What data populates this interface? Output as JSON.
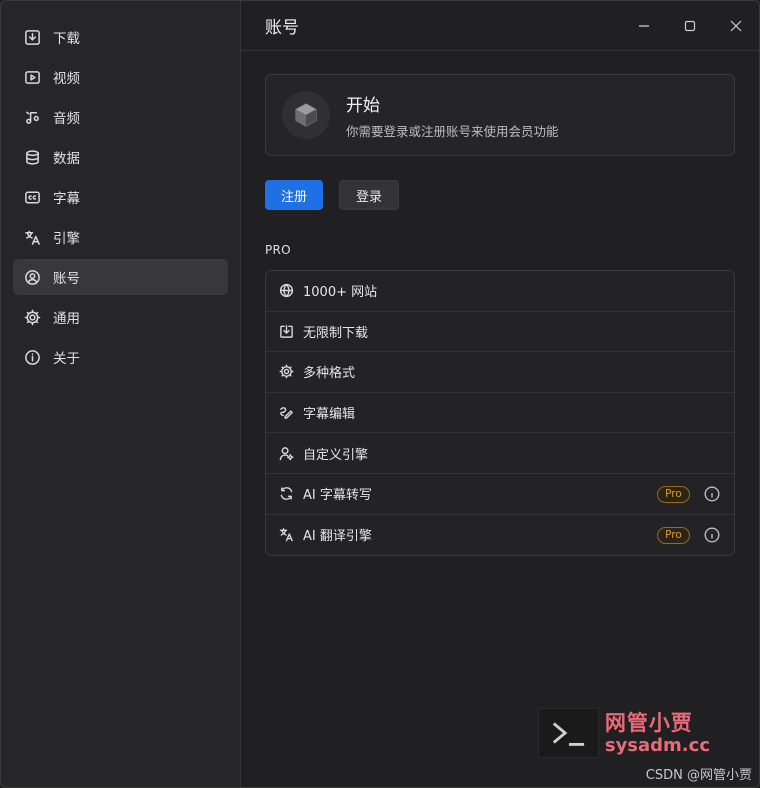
{
  "sidebar": {
    "items": [
      {
        "label": "下载",
        "icon": "download-icon",
        "active": false
      },
      {
        "label": "视频",
        "icon": "video-icon",
        "active": false
      },
      {
        "label": "音频",
        "icon": "audio-icon",
        "active": false
      },
      {
        "label": "数据",
        "icon": "database-icon",
        "active": false
      },
      {
        "label": "字幕",
        "icon": "subtitle-icon",
        "active": false
      },
      {
        "label": "引擎",
        "icon": "translate-icon",
        "active": false
      },
      {
        "label": "账号",
        "icon": "user-circle-icon",
        "active": true
      },
      {
        "label": "通用",
        "icon": "gear-icon",
        "active": false
      },
      {
        "label": "关于",
        "icon": "info-icon",
        "active": false
      }
    ]
  },
  "header": {
    "title": "账号"
  },
  "start_card": {
    "title": "开始",
    "description": "你需要登录或注册账号来使用会员功能"
  },
  "buttons": {
    "register": "注册",
    "login": "登录"
  },
  "pro_section": {
    "label": "PRO",
    "features": [
      {
        "label": "1000+ 网站",
        "icon": "globe-icon",
        "badge": ""
      },
      {
        "label": "无限制下载",
        "icon": "download-icon",
        "badge": ""
      },
      {
        "label": "多种格式",
        "icon": "gear-icon",
        "badge": ""
      },
      {
        "label": "字幕编辑",
        "icon": "subtitle-edit-icon",
        "badge": ""
      },
      {
        "label": "自定义引擎",
        "icon": "user-gear-icon",
        "badge": ""
      },
      {
        "label": "AI 字幕转写",
        "icon": "refresh-icon",
        "badge": "Pro"
      },
      {
        "label": "AI 翻译引擎",
        "icon": "translate-icon",
        "badge": "Pro"
      }
    ]
  },
  "watermark": {
    "cn": "网管小贾",
    "url": "sysadm.cc"
  },
  "footer": {
    "credit": "CSDN @网管小贾"
  },
  "colors": {
    "accent": "#1f6fe5",
    "pro_badge": "#d99a2c",
    "watermark": "#e96b7a"
  }
}
